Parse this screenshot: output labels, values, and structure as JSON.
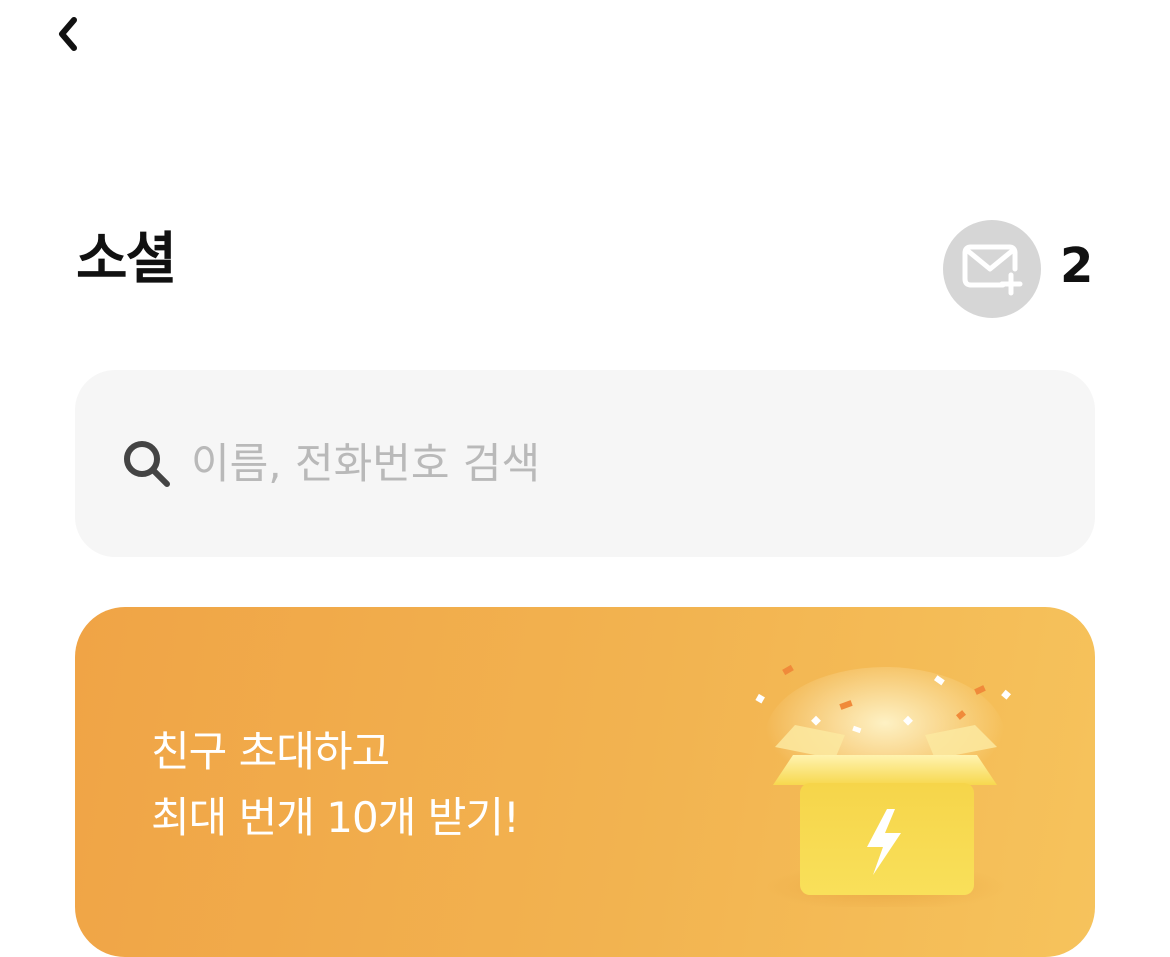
{
  "header": {
    "back_icon": "chevron-left-icon"
  },
  "page": {
    "title": "소셜"
  },
  "mail": {
    "icon": "mail-add-icon",
    "count": "2"
  },
  "search": {
    "icon": "search-icon",
    "placeholder": "이름, 전화번호 검색",
    "value": ""
  },
  "promo": {
    "line1": "친구 초대하고",
    "line2": "최대 번개 10개 받기!",
    "icon": "gift-box-icon",
    "colors": {
      "gradient_start": "#f0a446",
      "gradient_end": "#f6c35c",
      "box": "#f7d84e",
      "lightning": "#ffffff"
    }
  }
}
